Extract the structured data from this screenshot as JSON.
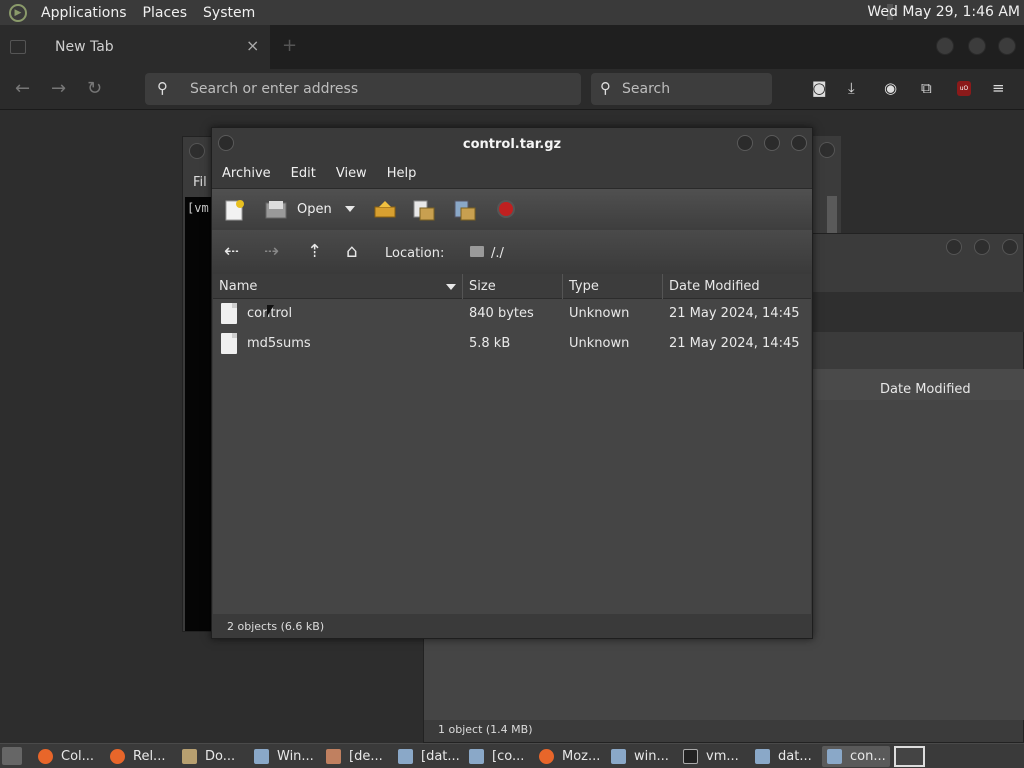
{
  "top_panel": {
    "menus": [
      "Applications",
      "Places",
      "System"
    ],
    "clock": "Wed May 29,  1:46 AM"
  },
  "browser": {
    "tab_title": "New Tab",
    "tab_close": "×",
    "new_tab": "+",
    "url_placeholder": "Search or enter address",
    "search_placeholder": "Search"
  },
  "background_windows": {
    "terminal_menu": "Fil",
    "terminal_text": "[vm",
    "fm_column": "Date Modified",
    "fm_status": "1 object (1.4 MB)"
  },
  "archive": {
    "title": "control.tar.gz",
    "menus": [
      "Archive",
      "Edit",
      "View",
      "Help"
    ],
    "open_label": "Open",
    "location_label": "Location:",
    "location_path": "/./",
    "columns": [
      "Name",
      "Size",
      "Type",
      "Date Modified"
    ],
    "rows": [
      {
        "name": "control",
        "size": "840 bytes",
        "type": "Unknown",
        "date": "21 May 2024, 14:45"
      },
      {
        "name": "md5sums",
        "size": "5.8 kB",
        "type": "Unknown",
        "date": "21 May 2024, 14:45"
      }
    ],
    "status": "2 objects (6.6 kB)"
  },
  "taskbar": {
    "tasks": [
      {
        "label": "Col...",
        "icon": "firefox-icon"
      },
      {
        "label": "Rel...",
        "icon": "firefox-icon"
      },
      {
        "label": "Do...",
        "icon": "folder-icon"
      },
      {
        "label": "Win...",
        "icon": "archive-icon"
      },
      {
        "label": "[de...",
        "icon": "text-editor-icon"
      },
      {
        "label": "[dat...",
        "icon": "archive-icon"
      },
      {
        "label": "[co...",
        "icon": "archive-icon"
      },
      {
        "label": "Moz...",
        "icon": "firefox-icon"
      },
      {
        "label": "win...",
        "icon": "archive-icon"
      },
      {
        "label": "vm...",
        "icon": "terminal-icon"
      },
      {
        "label": "dat...",
        "icon": "archive-icon"
      },
      {
        "label": "con...",
        "icon": "archive-icon"
      }
    ]
  },
  "colors": {
    "firefox": "#e8662a",
    "folder": "#b8a070",
    "archive": "#8aa8c8",
    "stop": "#c02020"
  }
}
